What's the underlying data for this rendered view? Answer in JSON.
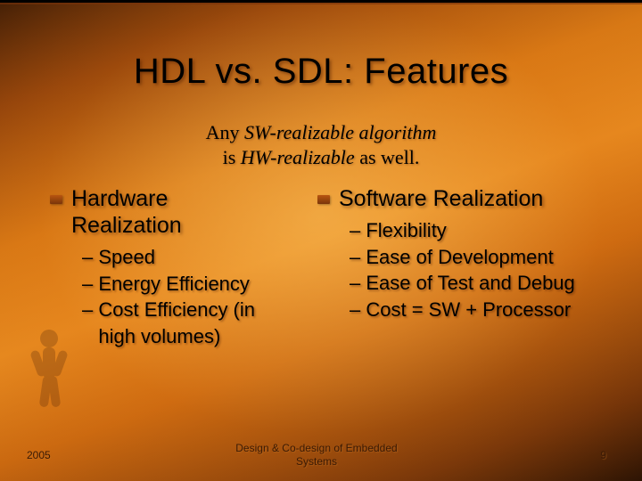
{
  "title": "HDL vs. SDL: Features",
  "subtitle": {
    "line1_pre": "Any ",
    "line1_em": "SW-realizable algorithm",
    "line2_pre": "is ",
    "line2_em": "HW-realizable",
    "line2_post": " as well."
  },
  "left": {
    "heading_l1": "Hardware",
    "heading_l2": "Realization",
    "items": [
      "– Speed",
      "– Energy Efficiency",
      "– Cost Efficiency (in",
      "   high volumes)"
    ]
  },
  "right": {
    "heading": "Software Realization",
    "items": [
      "– Flexibility",
      "– Ease of Development",
      "– Ease of Test and Debug",
      "– Cost = SW + Processor"
    ]
  },
  "footer": {
    "year": "2005",
    "center_l1": "Design & Co-design of Embedded",
    "center_l2": "Systems",
    "page": "9"
  }
}
